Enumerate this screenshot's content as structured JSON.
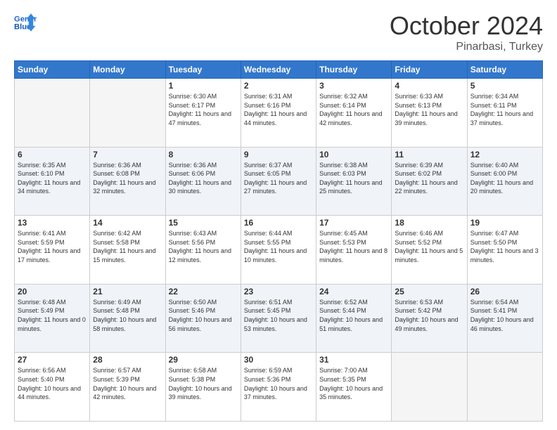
{
  "header": {
    "logo_general": "General",
    "logo_blue": "Blue",
    "month": "October 2024",
    "location": "Pinarbasi, Turkey"
  },
  "days_of_week": [
    "Sunday",
    "Monday",
    "Tuesday",
    "Wednesday",
    "Thursday",
    "Friday",
    "Saturday"
  ],
  "weeks": [
    [
      {
        "day": "",
        "sunrise": "",
        "sunset": "",
        "daylight": "",
        "empty": true
      },
      {
        "day": "",
        "sunrise": "",
        "sunset": "",
        "daylight": "",
        "empty": true
      },
      {
        "day": "1",
        "sunrise": "Sunrise: 6:30 AM",
        "sunset": "Sunset: 6:17 PM",
        "daylight": "Daylight: 11 hours and 47 minutes."
      },
      {
        "day": "2",
        "sunrise": "Sunrise: 6:31 AM",
        "sunset": "Sunset: 6:16 PM",
        "daylight": "Daylight: 11 hours and 44 minutes."
      },
      {
        "day": "3",
        "sunrise": "Sunrise: 6:32 AM",
        "sunset": "Sunset: 6:14 PM",
        "daylight": "Daylight: 11 hours and 42 minutes."
      },
      {
        "day": "4",
        "sunrise": "Sunrise: 6:33 AM",
        "sunset": "Sunset: 6:13 PM",
        "daylight": "Daylight: 11 hours and 39 minutes."
      },
      {
        "day": "5",
        "sunrise": "Sunrise: 6:34 AM",
        "sunset": "Sunset: 6:11 PM",
        "daylight": "Daylight: 11 hours and 37 minutes."
      }
    ],
    [
      {
        "day": "6",
        "sunrise": "Sunrise: 6:35 AM",
        "sunset": "Sunset: 6:10 PM",
        "daylight": "Daylight: 11 hours and 34 minutes."
      },
      {
        "day": "7",
        "sunrise": "Sunrise: 6:36 AM",
        "sunset": "Sunset: 6:08 PM",
        "daylight": "Daylight: 11 hours and 32 minutes."
      },
      {
        "day": "8",
        "sunrise": "Sunrise: 6:36 AM",
        "sunset": "Sunset: 6:06 PM",
        "daylight": "Daylight: 11 hours and 30 minutes."
      },
      {
        "day": "9",
        "sunrise": "Sunrise: 6:37 AM",
        "sunset": "Sunset: 6:05 PM",
        "daylight": "Daylight: 11 hours and 27 minutes."
      },
      {
        "day": "10",
        "sunrise": "Sunrise: 6:38 AM",
        "sunset": "Sunset: 6:03 PM",
        "daylight": "Daylight: 11 hours and 25 minutes."
      },
      {
        "day": "11",
        "sunrise": "Sunrise: 6:39 AM",
        "sunset": "Sunset: 6:02 PM",
        "daylight": "Daylight: 11 hours and 22 minutes."
      },
      {
        "day": "12",
        "sunrise": "Sunrise: 6:40 AM",
        "sunset": "Sunset: 6:00 PM",
        "daylight": "Daylight: 11 hours and 20 minutes."
      }
    ],
    [
      {
        "day": "13",
        "sunrise": "Sunrise: 6:41 AM",
        "sunset": "Sunset: 5:59 PM",
        "daylight": "Daylight: 11 hours and 17 minutes."
      },
      {
        "day": "14",
        "sunrise": "Sunrise: 6:42 AM",
        "sunset": "Sunset: 5:58 PM",
        "daylight": "Daylight: 11 hours and 15 minutes."
      },
      {
        "day": "15",
        "sunrise": "Sunrise: 6:43 AM",
        "sunset": "Sunset: 5:56 PM",
        "daylight": "Daylight: 11 hours and 12 minutes."
      },
      {
        "day": "16",
        "sunrise": "Sunrise: 6:44 AM",
        "sunset": "Sunset: 5:55 PM",
        "daylight": "Daylight: 11 hours and 10 minutes."
      },
      {
        "day": "17",
        "sunrise": "Sunrise: 6:45 AM",
        "sunset": "Sunset: 5:53 PM",
        "daylight": "Daylight: 11 hours and 8 minutes."
      },
      {
        "day": "18",
        "sunrise": "Sunrise: 6:46 AM",
        "sunset": "Sunset: 5:52 PM",
        "daylight": "Daylight: 11 hours and 5 minutes."
      },
      {
        "day": "19",
        "sunrise": "Sunrise: 6:47 AM",
        "sunset": "Sunset: 5:50 PM",
        "daylight": "Daylight: 11 hours and 3 minutes."
      }
    ],
    [
      {
        "day": "20",
        "sunrise": "Sunrise: 6:48 AM",
        "sunset": "Sunset: 5:49 PM",
        "daylight": "Daylight: 11 hours and 0 minutes."
      },
      {
        "day": "21",
        "sunrise": "Sunrise: 6:49 AM",
        "sunset": "Sunset: 5:48 PM",
        "daylight": "Daylight: 10 hours and 58 minutes."
      },
      {
        "day": "22",
        "sunrise": "Sunrise: 6:50 AM",
        "sunset": "Sunset: 5:46 PM",
        "daylight": "Daylight: 10 hours and 56 minutes."
      },
      {
        "day": "23",
        "sunrise": "Sunrise: 6:51 AM",
        "sunset": "Sunset: 5:45 PM",
        "daylight": "Daylight: 10 hours and 53 minutes."
      },
      {
        "day": "24",
        "sunrise": "Sunrise: 6:52 AM",
        "sunset": "Sunset: 5:44 PM",
        "daylight": "Daylight: 10 hours and 51 minutes."
      },
      {
        "day": "25",
        "sunrise": "Sunrise: 6:53 AM",
        "sunset": "Sunset: 5:42 PM",
        "daylight": "Daylight: 10 hours and 49 minutes."
      },
      {
        "day": "26",
        "sunrise": "Sunrise: 6:54 AM",
        "sunset": "Sunset: 5:41 PM",
        "daylight": "Daylight: 10 hours and 46 minutes."
      }
    ],
    [
      {
        "day": "27",
        "sunrise": "Sunrise: 6:56 AM",
        "sunset": "Sunset: 5:40 PM",
        "daylight": "Daylight: 10 hours and 44 minutes."
      },
      {
        "day": "28",
        "sunrise": "Sunrise: 6:57 AM",
        "sunset": "Sunset: 5:39 PM",
        "daylight": "Daylight: 10 hours and 42 minutes."
      },
      {
        "day": "29",
        "sunrise": "Sunrise: 6:58 AM",
        "sunset": "Sunset: 5:38 PM",
        "daylight": "Daylight: 10 hours and 39 minutes."
      },
      {
        "day": "30",
        "sunrise": "Sunrise: 6:59 AM",
        "sunset": "Sunset: 5:36 PM",
        "daylight": "Daylight: 10 hours and 37 minutes."
      },
      {
        "day": "31",
        "sunrise": "Sunrise: 7:00 AM",
        "sunset": "Sunset: 5:35 PM",
        "daylight": "Daylight: 10 hours and 35 minutes."
      },
      {
        "day": "",
        "sunrise": "",
        "sunset": "",
        "daylight": "",
        "empty": true
      },
      {
        "day": "",
        "sunrise": "",
        "sunset": "",
        "daylight": "",
        "empty": true
      }
    ]
  ]
}
